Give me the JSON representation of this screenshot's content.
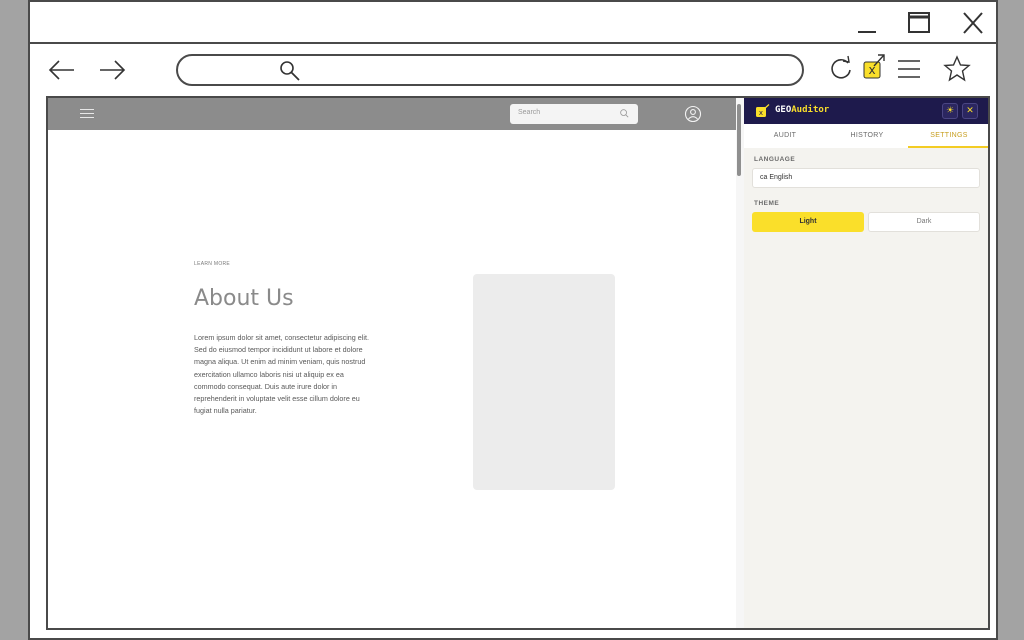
{
  "browser": {
    "icons": [
      "minimize-icon",
      "maximize-icon",
      "close-icon",
      "back-arrow-icon",
      "forward-arrow-icon",
      "search-icon",
      "reload-icon",
      "extension-icon",
      "menu-icon",
      "bookmark-star-icon"
    ]
  },
  "site": {
    "search_placeholder": "Search",
    "eyebrow": "LEARN MORE",
    "title": "About Us",
    "body": "Lorem ipsum dolor sit amet, consectetur adipiscing elit. Sed do eiusmod tempor incididunt ut labore et dolore magna aliqua. Ut enim ad minim veniam, quis nostrud exercitation ullamco laboris nisi ut aliquip ex ea commodo consequat. Duis aute irure dolor in reprehenderit in voluptate velit esse cillum dolore eu fugiat nulla pariatur."
  },
  "extension": {
    "title_prefix": "GEO",
    "title_accent": "Auditor",
    "theme_toggle_glyph": "☀",
    "close_glyph": "✕",
    "tabs": [
      {
        "label": "AUDIT"
      },
      {
        "label": "HISTORY"
      },
      {
        "label": "SETTINGS",
        "active": true
      }
    ],
    "settings": {
      "language_label": "LANGUAGE",
      "language_value": "ca English",
      "theme_label": "THEME",
      "theme_options": [
        "Light",
        "Dark"
      ],
      "theme_selected": "Light"
    },
    "colors": {
      "header_bg": "#1e1a4c",
      "accent_yellow": "#fadf2a",
      "active_tab": "#c79e1e"
    }
  }
}
